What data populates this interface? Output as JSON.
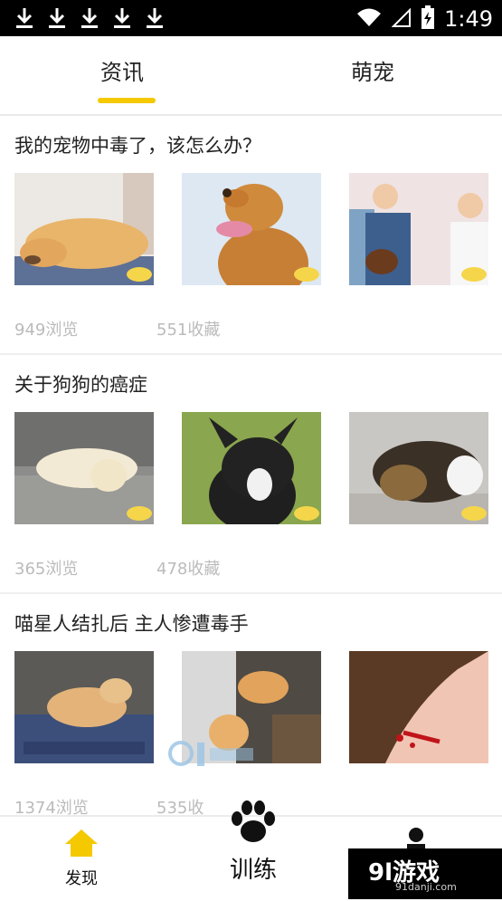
{
  "status_bar": {
    "time": "1:49",
    "download_icon_count": 5,
    "icons": [
      "download-icon",
      "wifi-icon",
      "signal-icon",
      "battery-charging-icon"
    ]
  },
  "tabs": {
    "left": "资讯",
    "right": "萌宠",
    "active": "资讯",
    "active_color": "#f4c900"
  },
  "cards": [
    {
      "title": "我的宠物中毒了，该怎么办？",
      "views": "949浏览",
      "saves": "551收藏",
      "thumbnails": [
        "sleeping-dog-illustration",
        "panting-dog-illustration",
        "vet-visit-illustration"
      ]
    },
    {
      "title": "关于狗狗的癌症",
      "views": "365浏览",
      "saves": "478收藏",
      "thumbnails": [
        "lying-labrador-photo",
        "boston-terrier-photo",
        "resting-terrier-photo"
      ]
    },
    {
      "title": "喵星人结扎后 主人惨遭毒手",
      "views": "1374浏览",
      "saves": "535收",
      "thumbnails": [
        "cat-on-table-photo",
        "cat-surgery-photo",
        "scratched-hand-photo"
      ]
    }
  ],
  "bottom_nav": {
    "discover": "发现",
    "train": "训练",
    "icons": [
      "home-icon",
      "paw-icon",
      "person-icon"
    ]
  },
  "watermark": {
    "brand": "9l游戏",
    "url": "91danji.com",
    "mid_brand": "9l游戏"
  }
}
